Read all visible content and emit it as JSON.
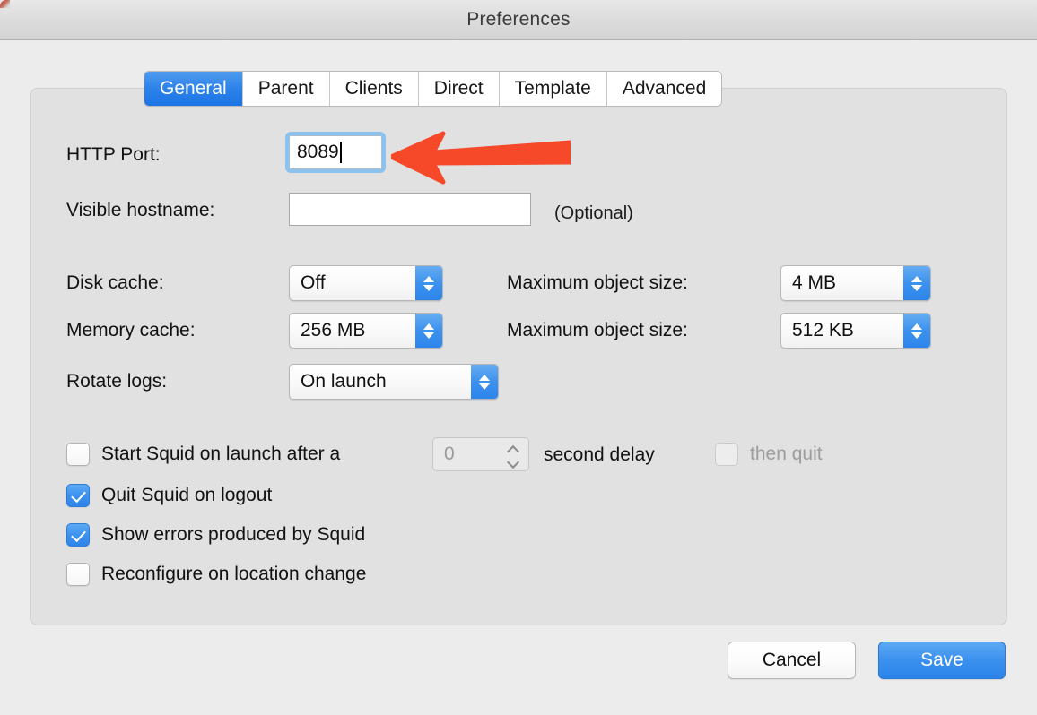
{
  "window": {
    "title": "Preferences"
  },
  "tabs": [
    {
      "label": "General",
      "active": true
    },
    {
      "label": "Parent",
      "active": false
    },
    {
      "label": "Clients",
      "active": false
    },
    {
      "label": "Direct",
      "active": false
    },
    {
      "label": "Template",
      "active": false
    },
    {
      "label": "Advanced",
      "active": false
    }
  ],
  "general": {
    "http_port": {
      "label": "HTTP Port:",
      "value": "8089",
      "placeholder": "",
      "focused": true
    },
    "visible_hostname": {
      "label": "Visible hostname:",
      "value": "",
      "placeholder": "",
      "hint": "(Optional)"
    },
    "disk_cache": {
      "label": "Disk cache:",
      "value": "Off"
    },
    "disk_max_object_size": {
      "label": "Maximum object size:",
      "value": "4 MB"
    },
    "memory_cache": {
      "label": "Memory cache:",
      "value": "256 MB"
    },
    "memory_max_object_size": {
      "label": "Maximum object size:",
      "value": "512 KB"
    },
    "rotate_logs": {
      "label": "Rotate logs:",
      "value": "On launch"
    },
    "start_on_launch": {
      "label": "Start Squid on launch after a",
      "checked": false,
      "delay_value": "0",
      "delay_suffix": "second delay",
      "then_quit_label": "then quit",
      "then_quit_checked": false,
      "then_quit_disabled": true
    },
    "quit_on_logout": {
      "label": "Quit Squid on logout",
      "checked": true
    },
    "show_errors": {
      "label": "Show errors produced by Squid",
      "checked": true
    },
    "reconfigure_on_location_change": {
      "label": "Reconfigure on location change",
      "checked": false
    }
  },
  "footer": {
    "cancel_label": "Cancel",
    "save_label": "Save"
  },
  "annotation": {
    "arrow_color": "#F5492A",
    "points_to": "http-port-input"
  },
  "colors": {
    "accent_blue": "#2E85EB",
    "window_background": "#ECECEC",
    "panel_background": "#E1E1E1",
    "focus_ring": "#8CC2EE",
    "annotation_red": "#F5492A"
  }
}
